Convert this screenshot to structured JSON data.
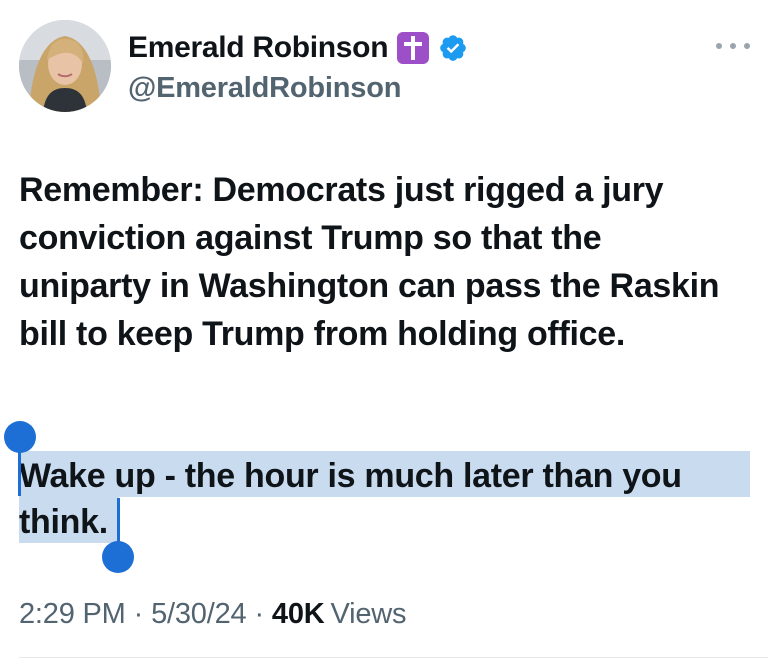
{
  "author": {
    "display_name": "Emerald Robinson",
    "handle": "@EmeraldRobinson",
    "name_emoji": "latin-cross-emoji",
    "verified": true,
    "verified_color": "#1d9bf0"
  },
  "tweet": {
    "paragraph1": "Remember: Democrats just rigged a jury conviction against Trump so that the uniparty in Washington can pass the Raskin bill to keep Trump from holding office.",
    "paragraph2_line1": "Wake up - the hour is much later than you",
    "paragraph2_line2": "think."
  },
  "meta": {
    "time": "2:29 PM",
    "date": "5/30/24",
    "separator": "·",
    "views_count": "40K",
    "views_label": "Views"
  },
  "selection": {
    "highlight_color": "#c9dbee",
    "handle_color": "#1d6fd6"
  },
  "icons": {
    "more": "more-options-icon",
    "verified": "verified-badge-icon"
  }
}
